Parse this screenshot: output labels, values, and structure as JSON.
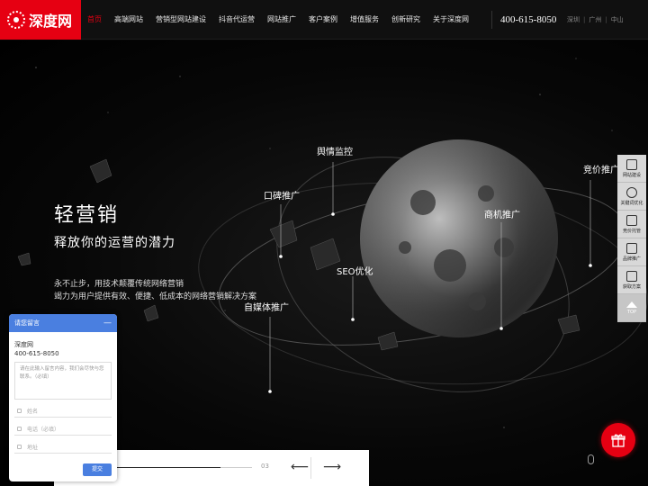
{
  "brand": {
    "logo_text": "深度网",
    "accent": "#e60012"
  },
  "nav": {
    "items": [
      "首页",
      "高端网站",
      "营销型网站建设",
      "抖音代运营",
      "网站推广",
      "客户案例",
      "增值服务",
      "创新研究",
      "关于深度网"
    ],
    "active_index": 0
  },
  "header": {
    "phone": "400-615-8050",
    "cities": [
      "深圳",
      "广州",
      "中山"
    ]
  },
  "hero": {
    "title": "轻营销",
    "subtitle": "释放你的运营的潜力",
    "desc_line1": "永不止步，用技术颠覆传统网络营销",
    "desc_line2": "竭力为用户提供有效、便捷、低成本的网络营销解决方案",
    "tags": [
      "舆情监控",
      "口碑推广",
      "竞价推广",
      "商机推广",
      "SEO优化",
      "自媒体推广"
    ]
  },
  "sidebar": {
    "items": [
      {
        "label": "网站建设",
        "icon": "monitor-icon"
      },
      {
        "label": "关键词优化",
        "icon": "target-icon"
      },
      {
        "label": "竞价托管",
        "icon": "chart-icon"
      },
      {
        "label": "品牌推广",
        "icon": "document-icon"
      },
      {
        "label": "获取方案",
        "icon": "clipboard-icon"
      }
    ],
    "top_label": "TOP"
  },
  "slider": {
    "count": "03",
    "prev_arrow": "⟵",
    "next_arrow": "⟶"
  },
  "chat": {
    "title": "请您留言",
    "minimize": "—",
    "company": "深度网",
    "phone": "400-615-8050",
    "message_placeholder": "请在此输入留言内容，我们会尽快与您联系。（必填）",
    "name_placeholder": "姓名",
    "phone_placeholder": "电话（必填）",
    "address_placeholder": "地址",
    "submit_label": "提交",
    "header_color": "#4a7fe0"
  }
}
